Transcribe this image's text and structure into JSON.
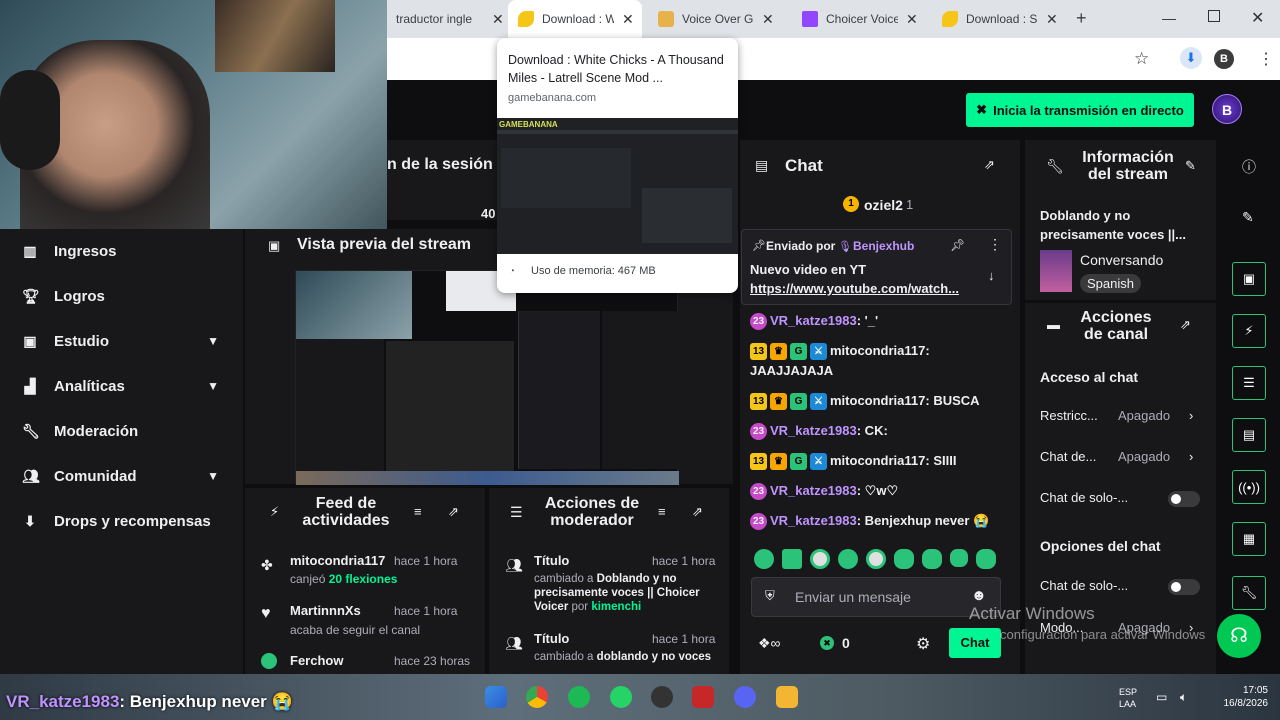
{
  "browser": {
    "tabs": [
      {
        "title": "traductor ingle",
        "favicon": "google-icon"
      },
      {
        "title": "Download : Wi",
        "favicon": "banana-icon"
      },
      {
        "title": "Voice Over Gar",
        "favicon": "gamebanana-icon"
      },
      {
        "title": "Choicer Voicer",
        "favicon": "twitch-icon"
      },
      {
        "title": "Download : Sp",
        "favicon": "banana-icon"
      }
    ],
    "new_tab": "+",
    "tooltip": {
      "title": "Download : White Chicks - A Thousand Miles - Latrell Scene Mod ...",
      "domain": "gamebanana.com",
      "memory": "Uso de memoria: 467 MB",
      "preview_logo": "GAMEBANANA"
    },
    "profile_letter": "B"
  },
  "header": {
    "live_button": "Inicia la transmisión en directo",
    "session_title": "n de la sesión",
    "session_num": "40"
  },
  "sidebar": {
    "items": [
      {
        "label": "Ingresos",
        "icon": "bar-chart-icon"
      },
      {
        "label": "Logros",
        "icon": "trophy-icon"
      },
      {
        "label": "Estudio",
        "icon": "studio-icon",
        "chevron": true
      },
      {
        "label": "Analíticas",
        "icon": "analytics-icon",
        "chevron": true
      },
      {
        "label": "Moderación",
        "icon": "wrench-icon"
      },
      {
        "label": "Comunidad",
        "icon": "community-icon",
        "chevron": true
      },
      {
        "label": "Drops y recompensas",
        "icon": "drops-icon"
      }
    ]
  },
  "preview": {
    "title": "Vista previa del stream"
  },
  "chat": {
    "title": "Chat",
    "top_user": "oziel2",
    "top_count": "1",
    "pinned_by_label": "Enviado por",
    "pinned_by_user": "Benjexhub",
    "pinned_text": "Nuevo video en YT",
    "pinned_link": "https://www.youtube.com/watch...",
    "messages": [
      {
        "user": "VR_katze1983",
        "text": ": '_'",
        "color": "purple",
        "badges": [
          "sub"
        ]
      },
      {
        "user": "mitocondria117",
        "text": ":",
        "cont": "JAAJJAJAJA",
        "color": "white",
        "badges": [
          "13",
          "crown",
          "gg",
          "sword"
        ]
      },
      {
        "user": "mitocondria117",
        "text": ": BUSCA",
        "color": "white",
        "badges": [
          "13",
          "crown",
          "gg",
          "sword"
        ]
      },
      {
        "user": "VR_katze1983",
        "text": ": CK:",
        "color": "purple",
        "badges": [
          "sub"
        ]
      },
      {
        "user": "mitocondria117",
        "text": ": SIIII",
        "color": "white",
        "badges": [
          "13",
          "crown",
          "gg",
          "sword"
        ]
      },
      {
        "user": "VR_katze1983",
        "text": ": ♡w♡",
        "color": "purple",
        "badges": [
          "sub"
        ]
      },
      {
        "user": "VR_katze1983",
        "text": ": Benjexhup never 😭",
        "color": "purple",
        "badges": [
          "sub"
        ]
      }
    ],
    "input_placeholder": "Enviar un mensaje",
    "points": "0",
    "send_button": "Chat"
  },
  "stream_info": {
    "title": "Información del stream",
    "stream_title": "Doblando y no precisamente voces ||...",
    "category": "Conversando",
    "language": "Spanish"
  },
  "channel_actions": {
    "title": "Acciones de canal",
    "chat_access": "Acceso al chat",
    "rows": [
      {
        "label": "Restricc...",
        "value": "Apagado"
      },
      {
        "label": "Chat de...",
        "value": "Apagado"
      }
    ],
    "solo_label": "Chat de solo-...",
    "chat_options": "Opciones del chat",
    "solo_label2": "Chat de solo-...",
    "mode_label": "Modo...",
    "mode_value": "Apagado"
  },
  "activity_feed": {
    "title": "Feed de actividades",
    "items": [
      {
        "user": "mitocondria117",
        "time": "hace 1 hora",
        "desc": "canjeó",
        "highlight": "20 flexiones"
      },
      {
        "user": "MartinnnXs",
        "time": "hace 1 hora",
        "desc": "acaba de seguir el canal",
        "highlight": ""
      },
      {
        "user": "Ferchow",
        "time": "hace 23 horas",
        "desc": "",
        "highlight": ""
      }
    ]
  },
  "mod_actions": {
    "title": "Acciones de moderador",
    "items": [
      {
        "title": "Título",
        "time": "hace 1 hora",
        "p1": "cambiado a",
        "p2": "Doblando y no precisamente voces || Choicer Voicer",
        "p3": "por",
        "p4": "kimenchi"
      },
      {
        "title": "Título",
        "time": "hace 1 hora",
        "p1": "cambiado a",
        "p2": "doblando y no voces",
        "p3": "",
        "p4": ""
      }
    ]
  },
  "overlay": {
    "watermark_title": "Activar Windows",
    "watermark_sub": "configuración para activar Windows",
    "ticker_user": "VR_katze1983",
    "ticker_text": ": Benjexhup never 😭"
  },
  "taskbar": {
    "lang": "ESP",
    "region": "LAA",
    "time": "17:05",
    "date": "16/8/2026"
  },
  "colors": {
    "accent": "#00f593",
    "purple": "#bf94ff",
    "bg": "#0e0e10",
    "panel": "#18181b"
  }
}
